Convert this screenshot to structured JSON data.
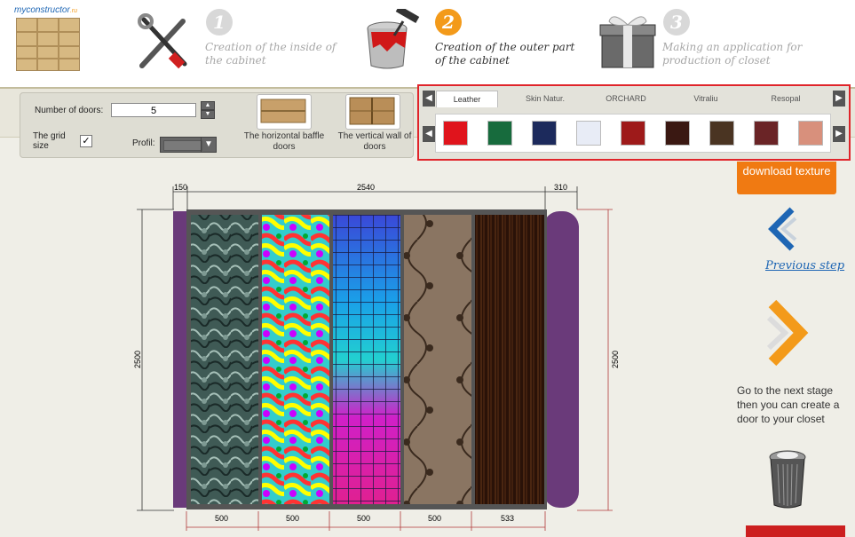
{
  "logo": {
    "brand": "myconstructor",
    "domain": ".ru"
  },
  "steps": [
    {
      "number": "1",
      "text": "Creation of the inside of the cabinet",
      "state": "done"
    },
    {
      "number": "2",
      "text": "Creation of the outer part of the cabinet",
      "state": "active"
    },
    {
      "number": "3",
      "text": "Making an application for production of closet",
      "state": "pending"
    }
  ],
  "settings": {
    "doors_label": "Number of doors:",
    "doors_value": "5",
    "grid_label": "The grid size",
    "grid_checked": "✓",
    "profil_label": "Profil:",
    "profil_value": "dark-grey",
    "baffle_h_label": "The horizontal baffle doors",
    "baffle_v_label": "The vertical wall of doors"
  },
  "texture_tabs": [
    "Leather",
    "Skin Natur.",
    "ORCHARD",
    "Vitraliu",
    "Resopal"
  ],
  "active_tab": "Leather",
  "swatches": [
    {
      "name": "swatch-red",
      "color": "#e0141c"
    },
    {
      "name": "swatch-green",
      "color": "#176b3d"
    },
    {
      "name": "swatch-navy",
      "color": "#1c2a5c"
    },
    {
      "name": "swatch-white",
      "color": "#e8ecf6"
    },
    {
      "name": "swatch-dark-red",
      "color": "#9e1a1a"
    },
    {
      "name": "swatch-dark-brown",
      "color": "#3a1812"
    },
    {
      "name": "swatch-brown",
      "color": "#4a3422"
    },
    {
      "name": "swatch-maroon",
      "color": "#6a2426"
    },
    {
      "name": "swatch-salmon",
      "color": "#d8907c"
    }
  ],
  "download_label": "download texture",
  "previous_step_label": "Previous step",
  "next_stage_text": "Go to the next stage then you can create a door to your closet",
  "drawing": {
    "left_side_width": "150",
    "main_width": "2540",
    "right_side_width": "310",
    "height_left": "2500",
    "height_right": "2500",
    "door_widths": [
      "500",
      "500",
      "500",
      "500",
      "533"
    ],
    "door_textures": [
      "marble-green",
      "psychedelic-colorful",
      "rainbow-grid",
      "brown-floral",
      "dark-wood"
    ],
    "side_color": "#6a3a7a"
  },
  "icons": {
    "tools": "tools-icon",
    "paint": "paint-bucket-icon",
    "gift": "gift-box-icon",
    "prev_arrow": "chevron-left-icon",
    "next_arrow": "chevron-right-icon",
    "trash": "trash-can-icon"
  }
}
